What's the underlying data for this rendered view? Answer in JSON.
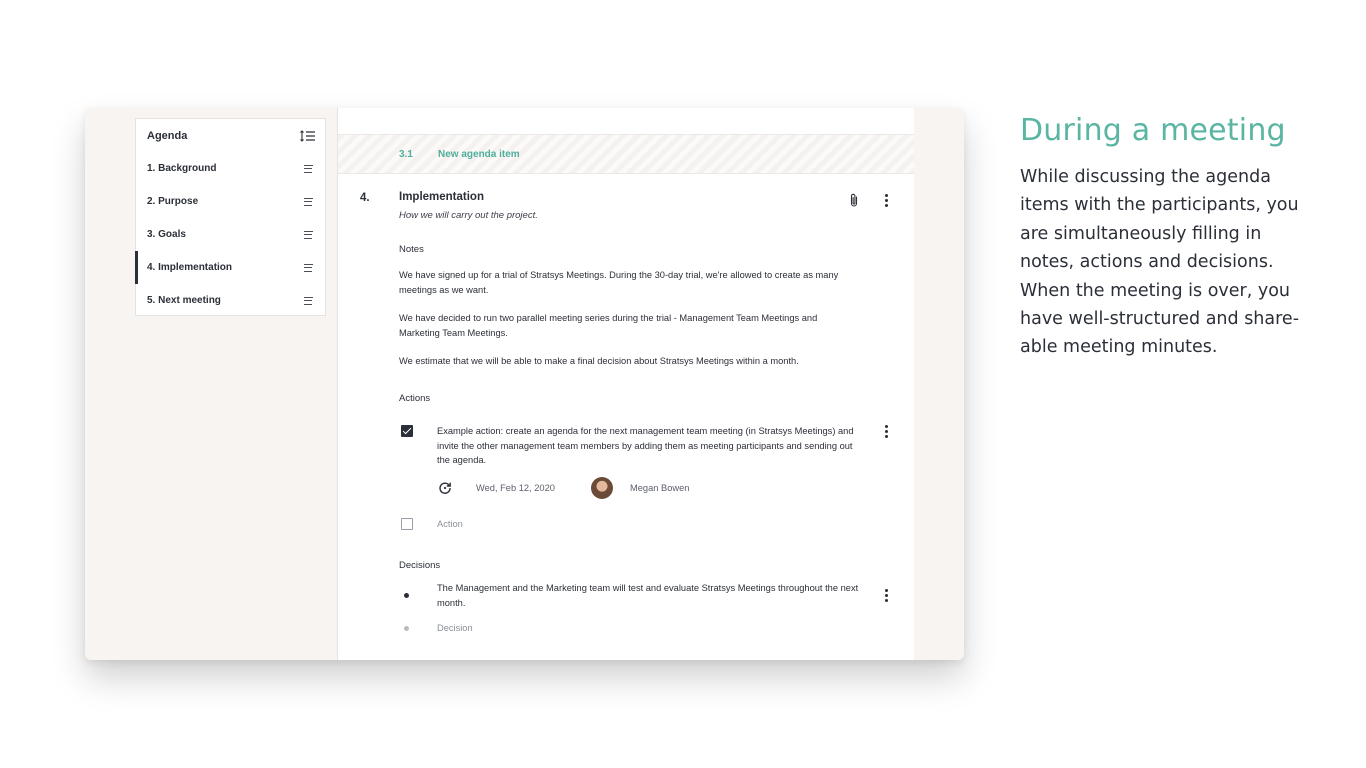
{
  "sidebar": {
    "title": "Agenda",
    "items": [
      {
        "label": "1.  Background"
      },
      {
        "label": "2.  Purpose"
      },
      {
        "label": "3.  Goals"
      },
      {
        "label": "4.  Implementation"
      },
      {
        "label": "5.  Next meeting"
      }
    ]
  },
  "new_item": {
    "number": "3.1",
    "label": "New agenda item"
  },
  "item": {
    "number": "4.",
    "title": "Implementation",
    "subtitle": "How we will carry out the project.",
    "notes_label": "Notes",
    "notes": [
      "We have signed up for a trial of Stratsys Meetings. During the 30-day trial, we're allowed to create as many meetings as we want.",
      "We have decided to run two parallel meeting series during the trial - Management Team Meetings and Marketing Team Meetings.",
      "We estimate that we will be able to make a final decision about Stratsys Meetings within a month."
    ],
    "actions_label": "Actions",
    "action": {
      "text": "Example action: create an agenda for the next management team meeting (in Stratsys Meetings) and invite the other management team members by adding them as meeting participants and sending out the agenda.",
      "date": "Wed, Feb 12, 2020",
      "assignee": "Megan Bowen",
      "checked": true
    },
    "action_placeholder": "Action",
    "decisions_label": "Decisions",
    "decision": "The Management and the Marketing team will test and evaluate Stratsys Meetings throughout the next month.",
    "decision_placeholder": "Decision"
  },
  "promo": {
    "heading": "During a meeting",
    "lines": [
      "While discussing the agenda",
      "items with the participants, you",
      "are simultaneously filling in",
      "notes, actions and decisions.",
      "When the meeting is over, you",
      "have well-structured and share-",
      "able meeting minutes."
    ]
  },
  "colors": {
    "accent": "#5ab5a2",
    "text": "#2b2f38",
    "panel_bg": "#f7f4f2"
  }
}
